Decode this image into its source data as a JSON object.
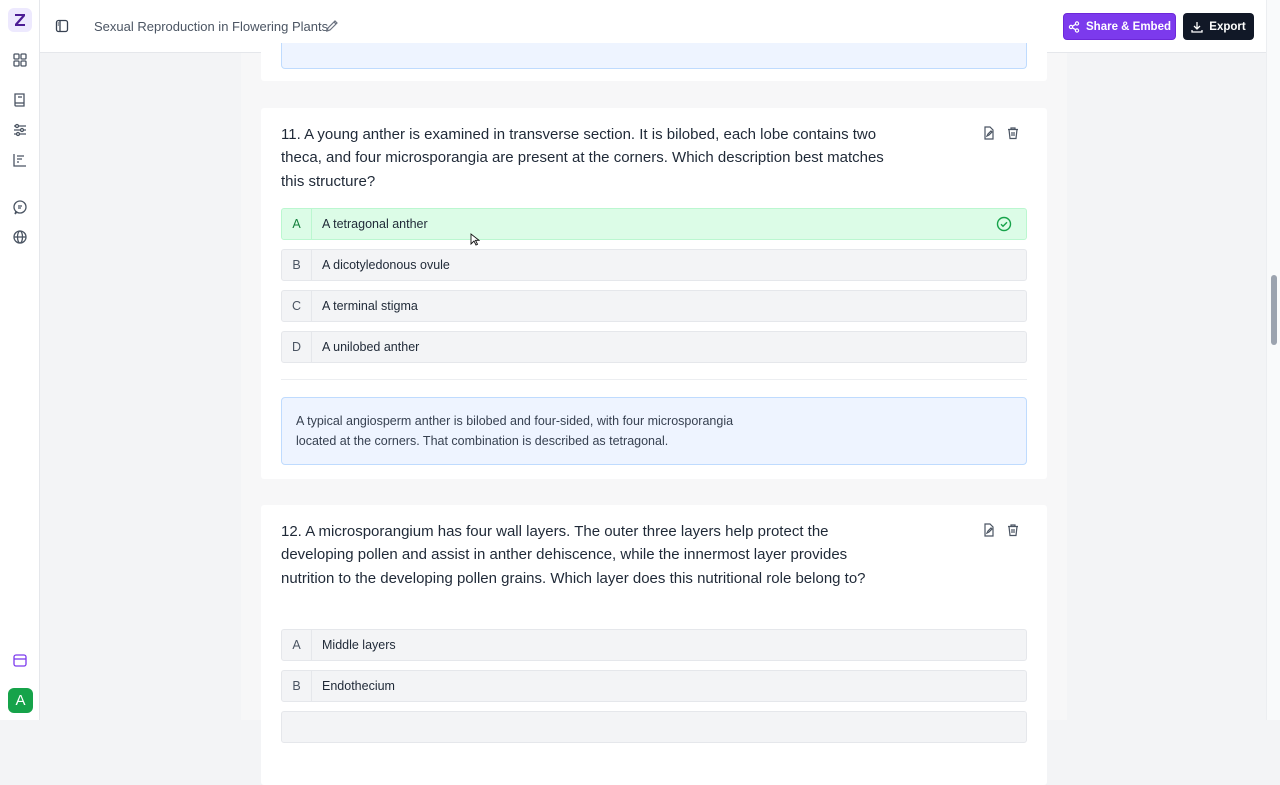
{
  "app": {
    "document_title": "Sexual Reproduction in Flowering Plants",
    "share_label": "Share & Embed",
    "export_label": "Export",
    "avatar_letter": "A",
    "accent_color": "#7c3aed",
    "correct_color": "#16a34a"
  },
  "questions": [
    {
      "number": "11.",
      "text": "11. A young anther is examined in transverse section. It is bilobed, each lobe contains two theca, and four microsporangia are present at the corners. Which description best matches this structure?",
      "options": [
        {
          "letter": "A",
          "text": "A tetragonal anther",
          "correct": true
        },
        {
          "letter": "B",
          "text": "A dicotyledonous ovule",
          "correct": false
        },
        {
          "letter": "C",
          "text": "A terminal stigma",
          "correct": false
        },
        {
          "letter": "D",
          "text": "A unilobed anther",
          "correct": false
        }
      ],
      "explanation": "A typical angiosperm anther is bilobed and four-sided, with four microsporangia located at the corners. That combination is described as tetragonal."
    },
    {
      "number": "12.",
      "text": "12. A microsporangium has four wall layers. The outer three layers help protect the developing pollen and assist in anther dehiscence, while the innermost layer provides nutrition to the developing pollen grains. Which layer does this nutritional role belong to?",
      "options": [
        {
          "letter": "A",
          "text": "Middle layers",
          "correct": false
        },
        {
          "letter": "B",
          "text": "Endothecium",
          "correct": false
        }
      ]
    }
  ],
  "icons": {
    "rail": [
      "logo-icon",
      "dashboard-icon",
      "book-icon",
      "sliders-icon",
      "chart-icon",
      "chat-icon",
      "globe-icon",
      "calendar-icon"
    ],
    "question_actions": [
      "edit-icon",
      "trash-icon"
    ]
  }
}
